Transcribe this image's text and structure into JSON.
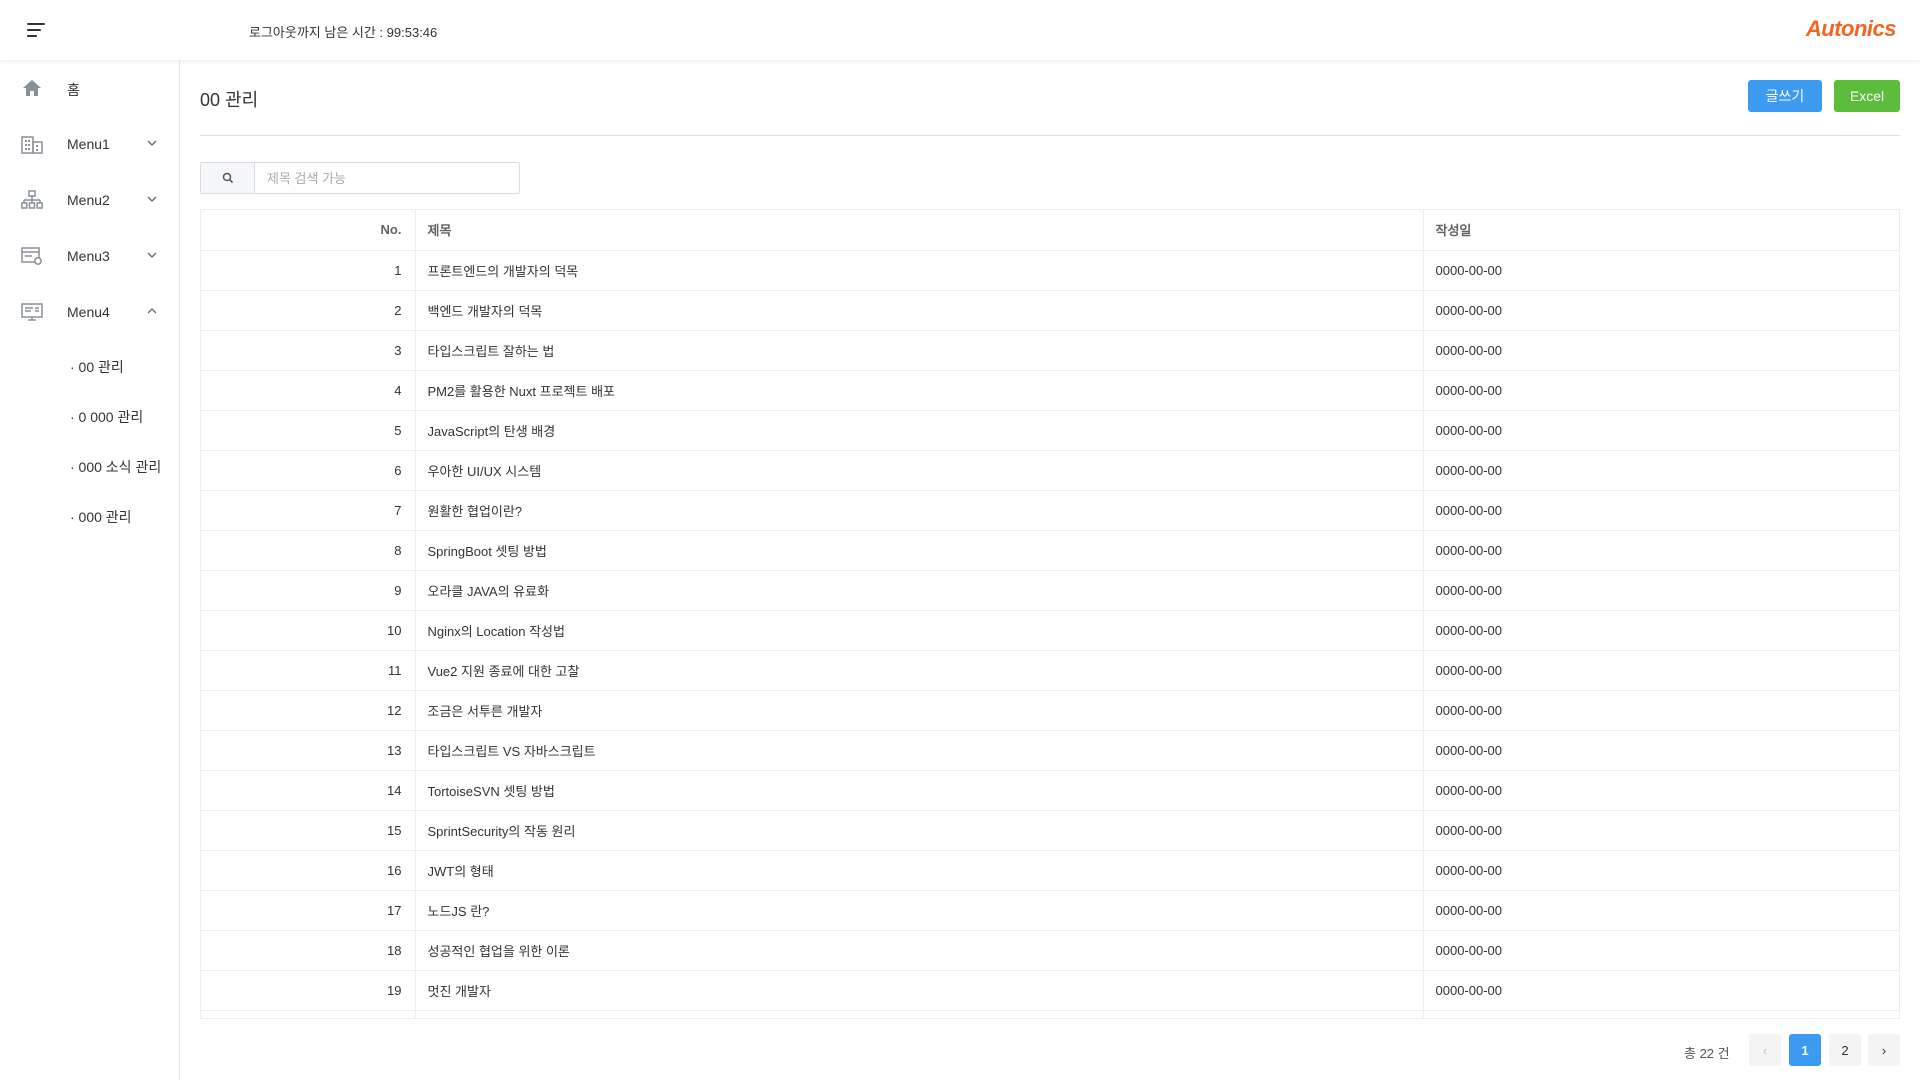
{
  "header": {
    "timer_label": "로그아웃까지 남은 시간 : 99:53:46",
    "logo": "Autonics",
    "logo_color": "#f26522"
  },
  "sidebar": {
    "home": {
      "label": "홈",
      "icon": "home-icon"
    },
    "items": [
      {
        "label": "Menu1",
        "icon": "building-icon",
        "expanded": false
      },
      {
        "label": "Menu2",
        "icon": "org-chart-icon",
        "expanded": false
      },
      {
        "label": "Menu3",
        "icon": "settings-list-icon",
        "expanded": false
      },
      {
        "label": "Menu4",
        "icon": "monitor-icon",
        "expanded": true
      }
    ],
    "sub_items": [
      "· 00 관리",
      "· 0 000 관리",
      "· 000 소식 관리",
      "· 000 관리"
    ]
  },
  "page": {
    "title": "00 관리",
    "write_button": "글쓰기",
    "excel_button": "Excel",
    "write_color": "#3c9bf0",
    "excel_color": "#5bbd3a"
  },
  "search": {
    "placeholder": "제목 검색 가능",
    "value": ""
  },
  "table": {
    "columns": [
      "No.",
      "제목",
      "작성일"
    ],
    "rows": [
      [
        "1",
        "프론트엔드의 개발자의 덕목",
        "0000-00-00"
      ],
      [
        "2",
        "백엔드 개발자의 덕목",
        "0000-00-00"
      ],
      [
        "3",
        "타입스크립트 잘하는 법",
        "0000-00-00"
      ],
      [
        "4",
        "PM2를 활용한 Nuxt 프로젝트 배포",
        "0000-00-00"
      ],
      [
        "5",
        "JavaScript의 탄생 배경",
        "0000-00-00"
      ],
      [
        "6",
        "우아한 UI/UX 시스템",
        "0000-00-00"
      ],
      [
        "7",
        "원활한 협업이란?",
        "0000-00-00"
      ],
      [
        "8",
        "SpringBoot 셋팅 방법",
        "0000-00-00"
      ],
      [
        "9",
        "오라클 JAVA의 유료화",
        "0000-00-00"
      ],
      [
        "10",
        "Nginx의 Location 작성법",
        "0000-00-00"
      ],
      [
        "11",
        "Vue2 지원 종료에 대한 고찰",
        "0000-00-00"
      ],
      [
        "12",
        "조금은 서투른 개발자",
        "0000-00-00"
      ],
      [
        "13",
        "타입스크립트 VS 자바스크립트",
        "0000-00-00"
      ],
      [
        "14",
        "TortoiseSVN 셋팅 방법",
        "0000-00-00"
      ],
      [
        "15",
        "SprintSecurity의 작동 원리",
        "0000-00-00"
      ],
      [
        "16",
        "JWT의 형태",
        "0000-00-00"
      ],
      [
        "17",
        "노드JS 란?",
        "0000-00-00"
      ],
      [
        "18",
        "성공적인 협업을 위한 이론",
        "0000-00-00"
      ],
      [
        "19",
        "멋진 개발자",
        "0000-00-00"
      ]
    ]
  },
  "pagination": {
    "total_label": "총 22 건",
    "prev": "‹",
    "next": "›",
    "pages": [
      "1",
      "2"
    ],
    "current": "1"
  }
}
